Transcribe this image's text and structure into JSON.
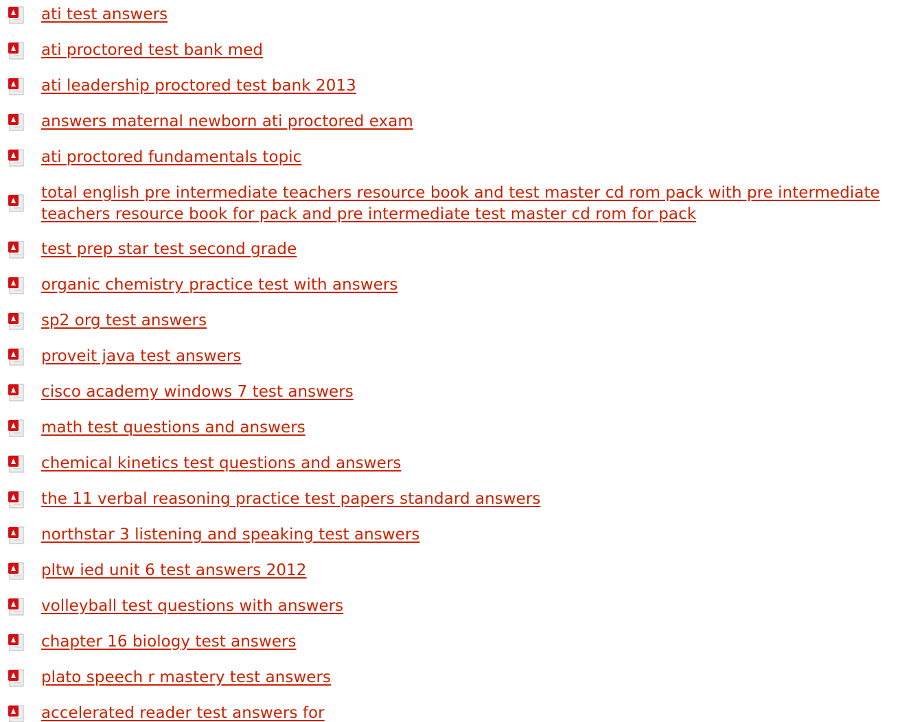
{
  "colors": {
    "link": "#cc2200",
    "icon_red": "#d40f14",
    "icon_paper": "#eeeeee",
    "background": "#ffffff"
  },
  "icon": "pdf-document-icon",
  "results": [
    {
      "label": "ati test answers"
    },
    {
      "label": "ati proctored test bank med"
    },
    {
      "label": "ati leadership proctored test bank 2013"
    },
    {
      "label": "answers maternal newborn ati proctored exam"
    },
    {
      "label": "ati proctored fundamentals topic"
    },
    {
      "label": "total english pre intermediate teachers resource book and test master cd rom pack with pre intermediate teachers resource book for pack and pre intermediate test master cd rom for pack"
    },
    {
      "label": "test prep star test second grade"
    },
    {
      "label": "organic chemistry practice test with answers"
    },
    {
      "label": "sp2 org test answers"
    },
    {
      "label": "proveit java test answers"
    },
    {
      "label": "cisco academy windows 7 test answers"
    },
    {
      "label": "math test questions and answers"
    },
    {
      "label": "chemical kinetics test questions and answers"
    },
    {
      "label": "the 11 verbal reasoning practice test papers standard answers"
    },
    {
      "label": "northstar 3 listening and speaking test answers"
    },
    {
      "label": "pltw ied unit 6 test answers 2012"
    },
    {
      "label": "volleyball test questions with answers"
    },
    {
      "label": "chapter 16 biology test answers"
    },
    {
      "label": "plato speech r mastery test answers"
    },
    {
      "label": "accelerated reader test answers for"
    }
  ]
}
